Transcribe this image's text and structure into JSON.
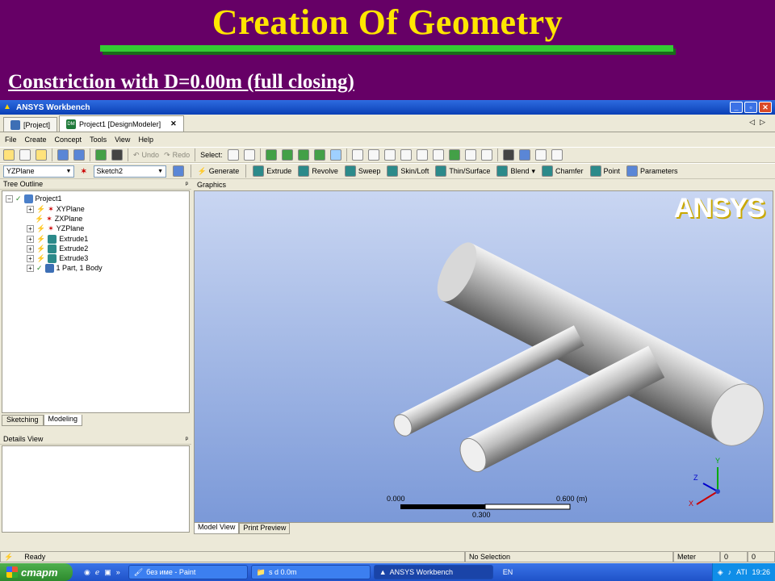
{
  "slide": {
    "title": "Creation Of Geometry",
    "subtitle": "Constriction with D=0.00m (full closing)"
  },
  "window": {
    "title": "ANSYS Workbench"
  },
  "tabs": [
    {
      "label": "[Project]"
    },
    {
      "label": "Project1 [DesignModeler]"
    }
  ],
  "menu": [
    "File",
    "Create",
    "Concept",
    "Tools",
    "View",
    "Help"
  ],
  "toolbar1": {
    "undo": "Undo",
    "redo": "Redo",
    "select": "Select:"
  },
  "toolbar2": {
    "plane_value": "YZPlane",
    "sketch_value": "Sketch2",
    "generate": "Generate",
    "extrude": "Extrude",
    "revolve": "Revolve",
    "sweep": "Sweep",
    "skinloft": "Skin/Loft",
    "thinsurface": "Thin/Surface",
    "blend": "Blend",
    "chamfer": "Chamfer",
    "point": "Point",
    "parameters": "Parameters"
  },
  "tree": {
    "header": "Tree Outline",
    "items": [
      {
        "label": "Project1"
      },
      {
        "label": "XYPlane"
      },
      {
        "label": "ZXPlane"
      },
      {
        "label": "YZPlane"
      },
      {
        "label": "Extrude1"
      },
      {
        "label": "Extrude2"
      },
      {
        "label": "Extrude3"
      },
      {
        "label": "1 Part, 1 Body"
      }
    ],
    "tabs": [
      "Sketching",
      "Modeling"
    ]
  },
  "details": {
    "header": "Details View"
  },
  "graphics": {
    "header": "Graphics",
    "logo": "ANSYS",
    "scale_left": "0.000",
    "scale_right": "0.600 (m)",
    "scale_mid": "0.300",
    "axis_y": "Y",
    "axis_z": "Z",
    "axis_x": "X",
    "tabs": [
      "Model View",
      "Print Preview"
    ]
  },
  "status": {
    "ready": "Ready",
    "selection": "No Selection",
    "unit": "Meter",
    "v1": "0",
    "v2": "0"
  },
  "taskbar": {
    "start": "старт",
    "tasks": [
      "без име - Paint",
      "s d  0.0m",
      "ANSYS Workbench"
    ],
    "lang": "EN",
    "clock": "19:26"
  },
  "colors": {
    "slide_bg": "#660066",
    "title": "#ffe600",
    "accent_bar": "#33cc33"
  }
}
